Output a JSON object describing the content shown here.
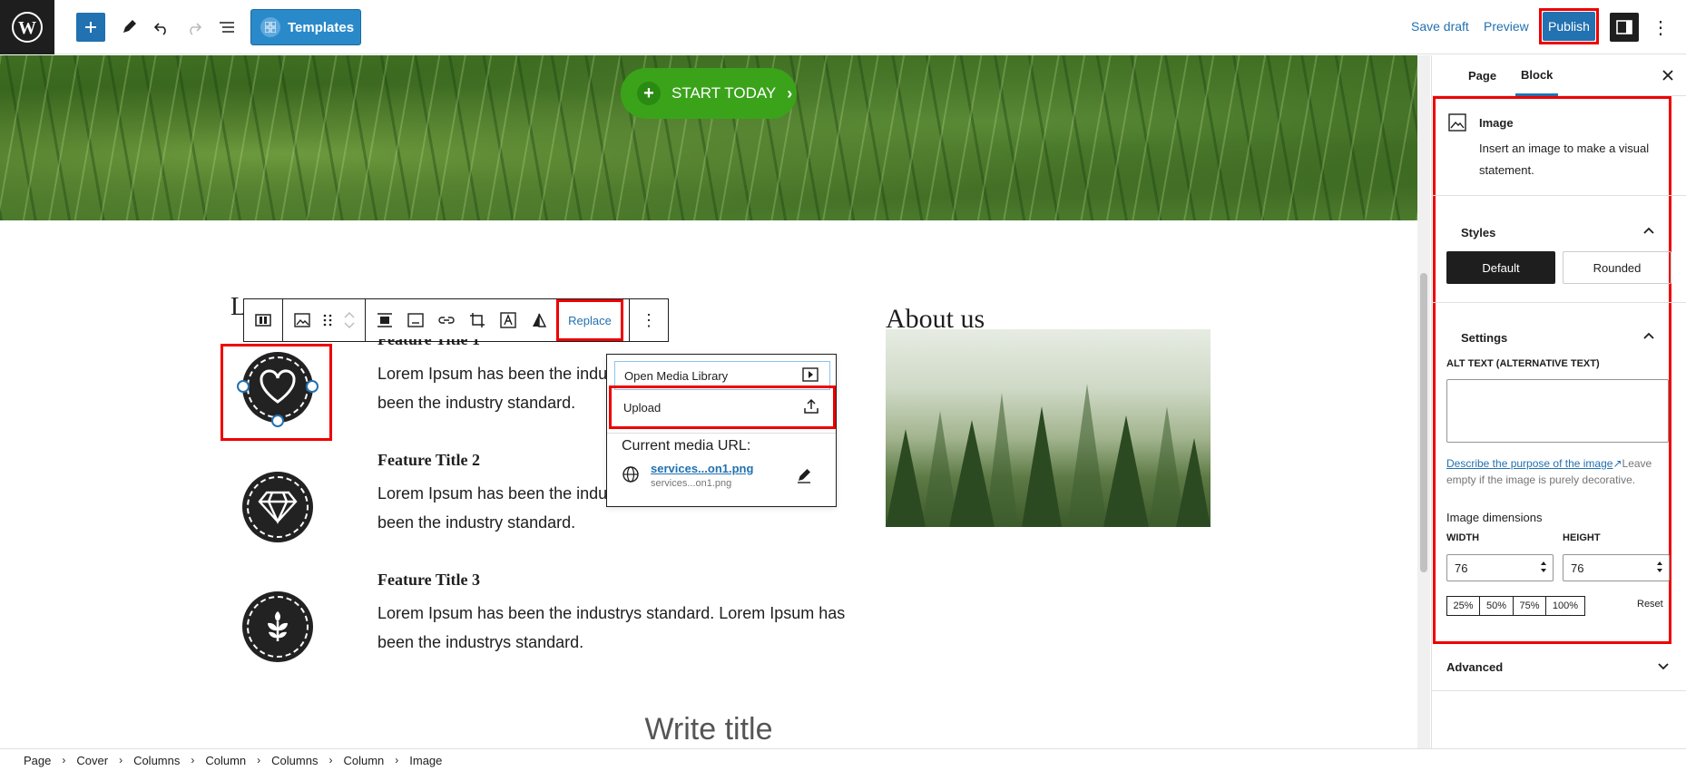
{
  "topbar": {
    "templates_label": "Templates",
    "save_draft": "Save draft",
    "preview": "Preview",
    "publish": "Publish",
    "more": "⋮"
  },
  "canvas": {
    "cta_label": "START TODAY",
    "heading_partial": "L",
    "features": [
      {
        "title": "Feature Title 1",
        "text": "Lorem Ipsum has been the industry's standard. Lorem Ipsum has been the industry standard."
      },
      {
        "title": "Feature Title 2",
        "text": "Lorem Ipsum has been the industry's standard. Lorem Ipsum has been the industry standard."
      },
      {
        "title": "Feature Title 3",
        "text": "Lorem Ipsum has been the industrys standard. Lorem Ipsum has been the industrys standard."
      }
    ],
    "feature1_line1": "Lorem Ipsum has been the indus",
    "feature1_line2": "been the industry standard.",
    "feature2_line1": "Lorem Ipsum has been the indus",
    "feature2_line2": "been the industry standard.",
    "feature3_line1": "Lorem Ipsum has been the industrys standard. Lorem Ipsum has",
    "feature3_line2": "been the industrys standard.",
    "about_heading": "About us",
    "write_title": "Write title"
  },
  "block_toolbar": {
    "replace_label": "Replace"
  },
  "replace_popover": {
    "open_media_library": "Open Media Library",
    "upload": "Upload",
    "current_media_url_label": "Current media URL:",
    "url_link": "services...on1.png",
    "url_sub": "services...on1.png"
  },
  "sidebar": {
    "tabs": [
      "Page",
      "Block"
    ],
    "active_tab": "Block",
    "block_name": "Image",
    "block_description": "Insert an image to make a visual statement.",
    "styles_heading": "Styles",
    "style_default": "Default",
    "style_rounded": "Rounded",
    "settings_heading": "Settings",
    "alt_label": "ALT TEXT (ALTERNATIVE TEXT)",
    "alt_value": "",
    "alt_help_link": "Describe the purpose of the image",
    "alt_help_rest": "Leave empty if the image is purely decorative.",
    "dimensions_heading": "Image dimensions",
    "width_label": "WIDTH",
    "height_label": "HEIGHT",
    "width_value": "76",
    "height_value": "76",
    "percent_options": [
      "25%",
      "50%",
      "75%",
      "100%"
    ],
    "reset": "Reset",
    "advanced_heading": "Advanced"
  },
  "breadcrumbs": [
    "Page",
    "Cover",
    "Columns",
    "Column",
    "Columns",
    "Column",
    "Image"
  ],
  "colors": {
    "accent": "#2271b1",
    "highlight_outline": "#ee0000",
    "cta_green": "#3aa31a"
  }
}
